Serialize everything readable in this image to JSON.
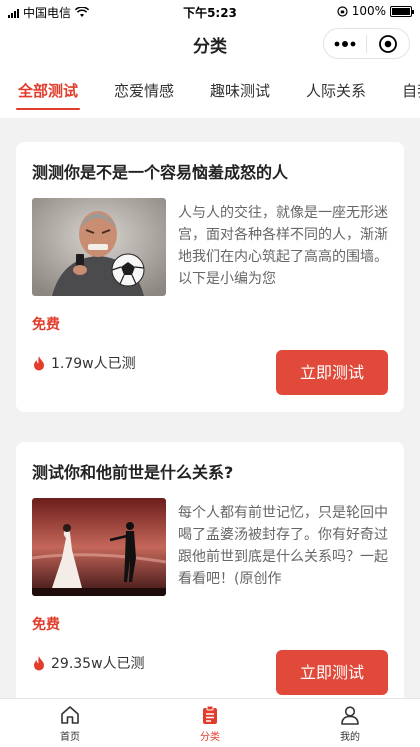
{
  "statusbar": {
    "carrier": "中国电信",
    "time": "下午5:23",
    "battery": "100%"
  },
  "navbar": {
    "title": "分类"
  },
  "tabs": [
    {
      "label": "全部测试",
      "active": true
    },
    {
      "label": "恋爱情感",
      "active": false
    },
    {
      "label": "趣味测试",
      "active": false
    },
    {
      "label": "人际关系",
      "active": false
    },
    {
      "label": "自我",
      "active": false
    }
  ],
  "cards": [
    {
      "title": "测测你是不是一个容易恼羞成怒的人",
      "description": "人与人的交往，就像是一座无形迷宫，面对各种各样不同的人，渐渐地我们在内心筑起了高高的围墙。以下是小编为您",
      "price": "免费",
      "count": "1.79w人已测",
      "cta": "立即测试"
    },
    {
      "title": "测试你和他前世是什么关系?",
      "description": "每个人都有前世记忆，只是轮回中喝了孟婆汤被封存了。你有好奇过跟他前世到底是什么关系吗？一起看看吧！(原创作",
      "price": "免费",
      "count": "29.35w人已测",
      "cta": "立即测试"
    }
  ],
  "bottombar": [
    {
      "label": "首页",
      "icon": "home-icon"
    },
    {
      "label": "分类",
      "icon": "clipboard-icon",
      "active": true
    },
    {
      "label": "我的",
      "icon": "user-icon"
    }
  ],
  "colors": {
    "accent": "#e23d2c",
    "button": "#e14a3a"
  }
}
